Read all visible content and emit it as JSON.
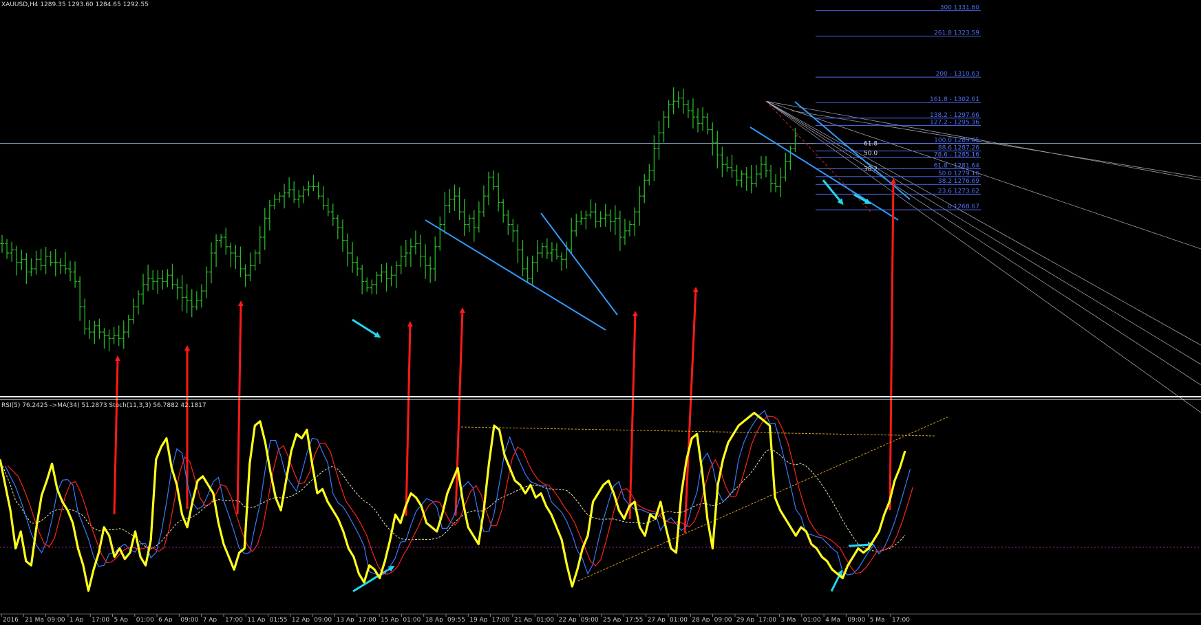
{
  "header": {
    "symbol_info": "XAUUSD,H4  1289.35 1293.60 1284.65 1292.55",
    "oscillator_info": "RSI(5) 76.2425  ->MA(34) 51.2873  Stoch(11,3,3) 56.7882 42.1817"
  },
  "colors": {
    "background": "#000000",
    "bars": "#27b827",
    "trendlines": "#2f9bff",
    "arrows_red": "#ff1a1a",
    "arrows_cyan": "#22d8f0",
    "rsi": "#ffff1a",
    "stoch_main": "#3a78ff",
    "stoch_signal": "#ff2222",
    "fib_levels": "#4f6df0",
    "fan_lines": "#b8b8c8",
    "price_line": "#8aa4c8",
    "separator": "#ffffff"
  },
  "chart_data": [
    {
      "type": "bar",
      "title": "XAUUSD,H4",
      "description": "OHLC price chart (H4)",
      "ohlc_last": {
        "open": 1289.35,
        "high": 1293.6,
        "low": 1284.65,
        "close": 1292.55
      },
      "ylim": [
        1210,
        1335
      ],
      "current_price_line": 1289.65,
      "closes": [
        1258,
        1255,
        1256,
        1252,
        1253,
        1249,
        1250,
        1253,
        1251,
        1254,
        1252,
        1252,
        1251,
        1250,
        1249,
        1246,
        1238,
        1231,
        1230,
        1232,
        1230,
        1229,
        1228,
        1229,
        1228,
        1230,
        1234,
        1238,
        1242,
        1245,
        1247,
        1246,
        1247,
        1246,
        1248,
        1245,
        1244,
        1241,
        1240,
        1238,
        1240,
        1243,
        1249,
        1255,
        1259,
        1260,
        1257,
        1255,
        1254,
        1250,
        1248,
        1251,
        1255,
        1260,
        1266,
        1270,
        1272,
        1273,
        1274,
        1275,
        1272,
        1273,
        1275,
        1276,
        1276,
        1273,
        1270,
        1268,
        1266,
        1263,
        1259,
        1255,
        1252,
        1250,
        1246,
        1244,
        1245,
        1248,
        1249,
        1247,
        1248,
        1251,
        1254,
        1255,
        1257,
        1258,
        1254,
        1251,
        1250,
        1257,
        1264,
        1270,
        1272,
        1273,
        1268,
        1264,
        1266,
        1263,
        1268,
        1273,
        1279,
        1276,
        1271,
        1267,
        1264,
        1262,
        1256,
        1250,
        1247,
        1252,
        1255,
        1257,
        1255,
        1256,
        1254,
        1253,
        1256,
        1262,
        1265,
        1266,
        1267,
        1268,
        1265,
        1266,
        1267,
        1265,
        1266,
        1260,
        1262,
        1264,
        1268,
        1273,
        1278,
        1281,
        1288,
        1293,
        1298,
        1302,
        1303,
        1304,
        1302,
        1300,
        1298,
        1296,
        1298,
        1294,
        1290,
        1286,
        1283,
        1282,
        1281,
        1278,
        1280,
        1279,
        1277,
        1280,
        1283,
        1281,
        1277,
        1276,
        1279,
        1284,
        1288,
        1292
      ],
      "fibonacci_levels": [
        {
          "label": "300 1331.60",
          "value": 1331.6
        },
        {
          "label": "261.8 1323.59",
          "value": 1323.59
        },
        {
          "label": "200 - 1310.63",
          "value": 1310.63
        },
        {
          "label": "161.8 - 1302.61",
          "value": 1302.61
        },
        {
          "label": "138.2 - 1297.66",
          "value": 1297.66
        },
        {
          "label": "127.2 - 1295.36",
          "value": 1295.36
        },
        {
          "label": "100.0 1289.65",
          "value": 1289.65
        },
        {
          "label": "88.6 1287.26",
          "value": 1287.26
        },
        {
          "label": "78.6 - 1285.16",
          "value": 1285.16
        },
        {
          "label": "61.8 - 1281.64",
          "value": 1281.64
        },
        {
          "label": "50.0 1279.16",
          "value": 1279.16
        },
        {
          "label": "38.2 1276.69",
          "value": 1276.69
        },
        {
          "label": "23.6 1273.62",
          "value": 1273.62
        },
        {
          "label": "0 1268.67",
          "value": 1268.67
        }
      ],
      "retracement_labels": [
        "61.8",
        "50.0",
        "38.2"
      ]
    },
    {
      "type": "line",
      "title": "RSI(5) 76.2425 ->MA(34) 51.2873 Stoch(11,3,3) 56.7882 42.1817",
      "ylim": [
        0,
        100
      ],
      "series": [
        {
          "name": "RSI(5)",
          "last": 76.2425,
          "values": [
            72,
            60,
            48,
            30,
            38,
            24,
            22,
            40,
            55,
            62,
            70,
            58,
            52,
            48,
            42,
            30,
            22,
            10,
            20,
            28,
            40,
            36,
            26,
            30,
            25,
            28,
            38,
            26,
            22,
            34,
            72,
            78,
            82,
            68,
            60,
            46,
            40,
            52,
            62,
            64,
            60,
            56,
            42,
            32,
            26,
            20,
            28,
            30,
            70,
            88,
            90,
            80,
            66,
            54,
            48,
            62,
            76,
            84,
            82,
            86,
            70,
            56,
            58,
            52,
            48,
            44,
            38,
            30,
            26,
            18,
            14,
            22,
            20,
            16,
            24,
            34,
            46,
            42,
            50,
            56,
            54,
            50,
            42,
            40,
            38,
            46,
            56,
            62,
            68,
            52,
            40,
            36,
            32,
            48,
            70,
            88,
            86,
            74,
            68,
            62,
            60,
            56,
            60,
            54,
            56,
            50,
            46,
            40,
            34,
            22,
            12,
            20,
            30,
            36,
            52,
            56,
            60,
            62,
            56,
            48,
            44,
            50,
            52,
            40,
            36,
            46,
            44,
            52,
            40,
            30,
            28,
            56,
            72,
            82,
            84,
            66,
            44,
            30,
            60,
            72,
            80,
            84,
            88,
            90,
            92,
            94,
            92,
            90,
            88,
            54,
            48,
            44,
            40,
            36,
            40,
            38,
            32,
            30,
            26,
            24,
            20,
            18,
            16,
            22,
            26,
            30,
            28,
            30,
            34,
            38,
            46,
            52,
            62,
            68,
            76
          ]
        },
        {
          "name": "MA(34)",
          "last": 51.2873
        },
        {
          "name": "Stoch(11,3,3) main",
          "last": 56.7882
        },
        {
          "name": "Stoch(11,3,3) signal",
          "last": 42.1817
        }
      ]
    }
  ],
  "time_axis": {
    "labels": [
      "2016",
      "21 Ma",
      "09:00",
      "1 Ap",
      "17:00",
      "5 Ap",
      "01:00",
      "6 Ap",
      "09:00",
      "7 Ap",
      "17:00",
      "11 Ap",
      "01:55",
      "12 Ap",
      "09:00",
      "13 Ap",
      "17:00",
      "15 Ap",
      "01:00",
      "18 Ap",
      "09:55",
      "19 Ap",
      "17:00",
      "21 Ap",
      "01:00",
      "22 Ap",
      "09:00",
      "25 Ap",
      "17:55",
      "27 Ap",
      "01:00",
      "28 Ap",
      "09:00",
      "29 Ap",
      "17:00",
      "3 Ma",
      "01:00",
      "4 Ma",
      "09:00",
      "5 Ma",
      "17:00"
    ]
  }
}
